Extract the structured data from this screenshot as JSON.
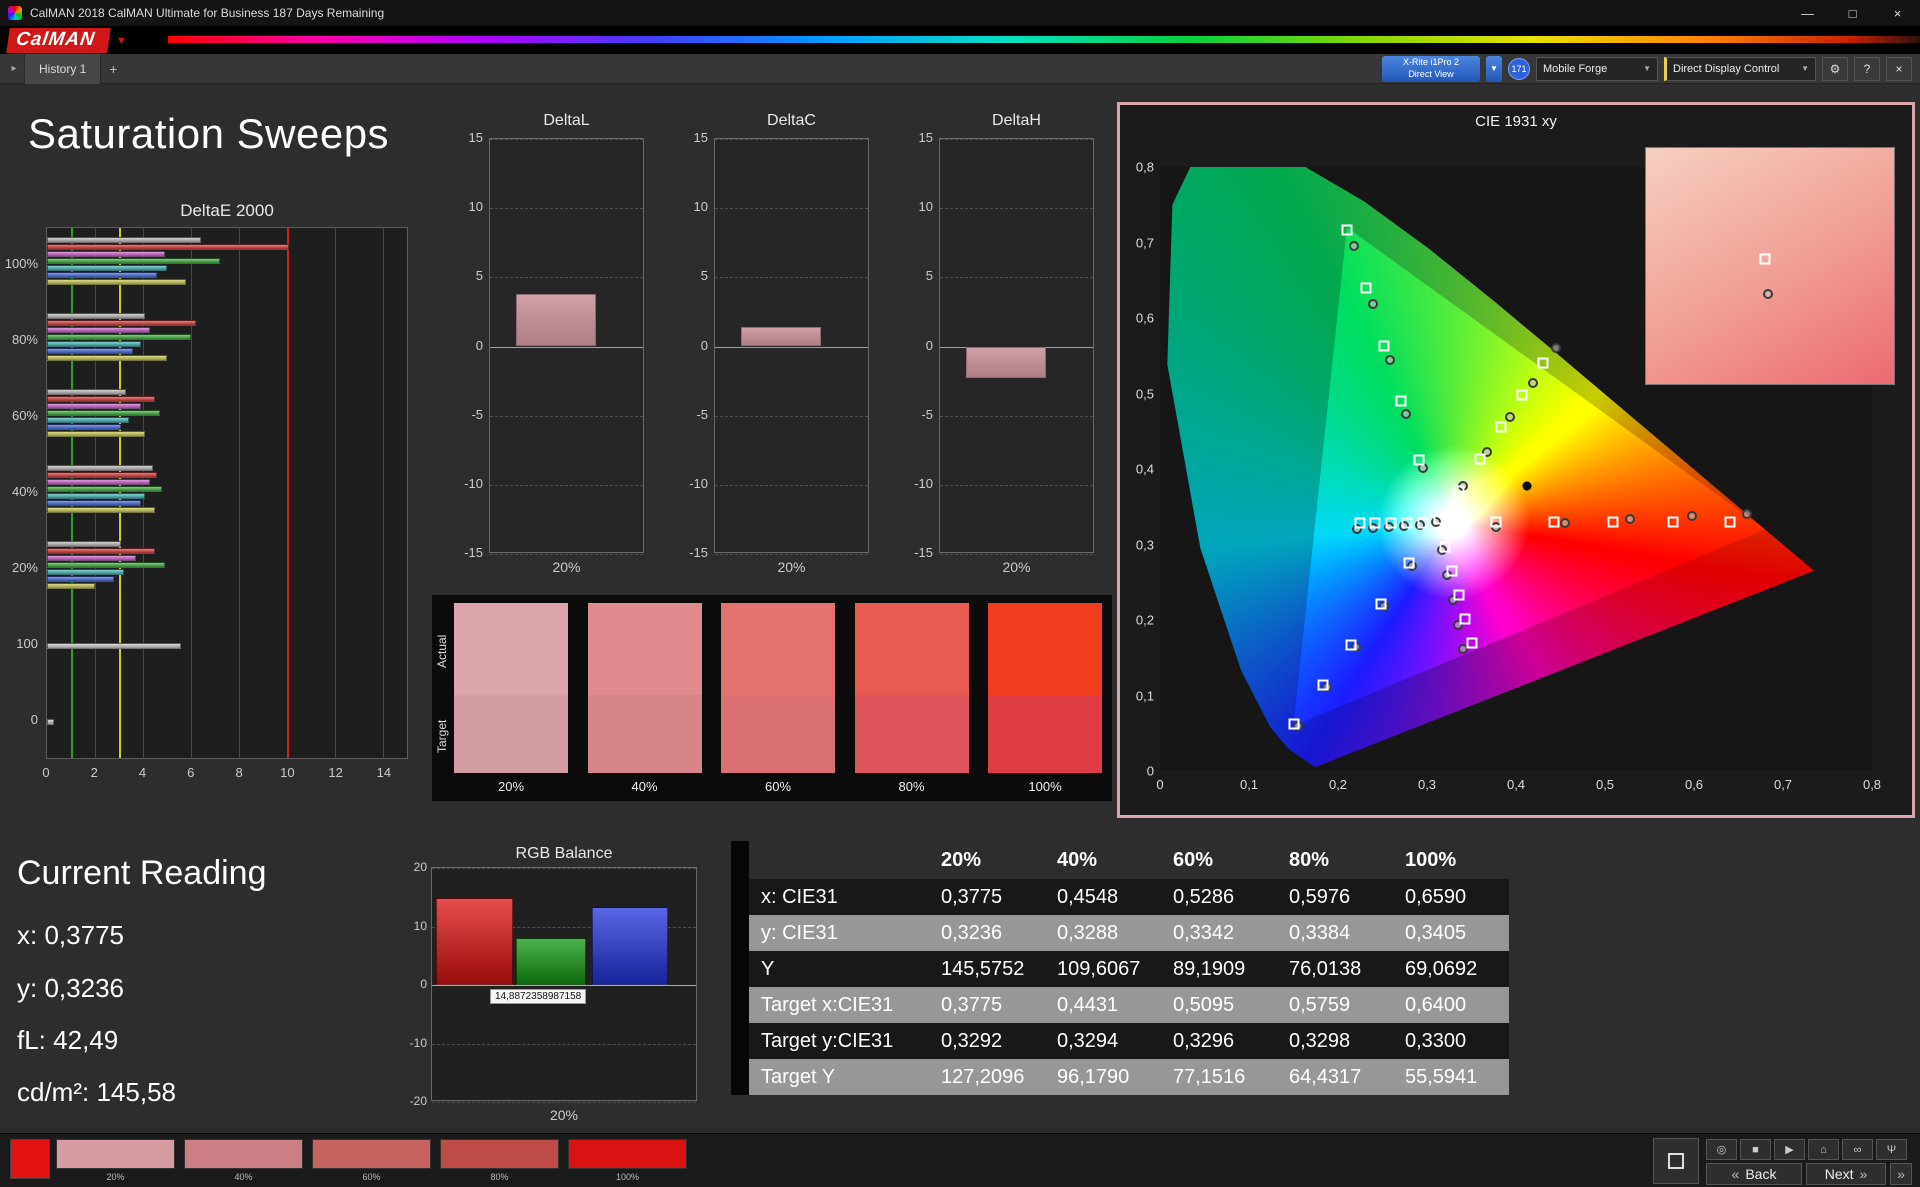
{
  "window": {
    "title": "CalMAN 2018 CalMAN Ultimate for Business 187 Days Remaining",
    "minimize_glyph": "—",
    "maximize_glyph": "□",
    "close_glyph": "×"
  },
  "brand": {
    "logo_text": "CalMAN",
    "caret_glyph": "▼"
  },
  "tab_bar": {
    "nav_glyph": "▸",
    "history_tab": "History 1",
    "add_tab_glyph": "+"
  },
  "device_bar": {
    "meter_line1": "X-Rite i1Pro 2",
    "meter_line2": "Direct View",
    "caret_glyph": "▼",
    "badge": "171",
    "source": "Mobile Forge",
    "display_control": "Direct Display Control",
    "gear_glyph": "⚙",
    "help_glyph": "?",
    "close_glyph": "×"
  },
  "page": {
    "title": "Saturation Sweeps"
  },
  "current_reading": {
    "title": "Current Reading",
    "x_label": "x:",
    "x_value": "0,3775",
    "y_label": "y:",
    "y_value": "0,3236",
    "fl_label": "fL:",
    "fl_value": "42,49",
    "cd_label": "cd/m²:",
    "cd_value": "145,58"
  },
  "chart_data": {
    "deltae2000": {
      "type": "bar",
      "title": "DeltaE 2000",
      "xlim": [
        0,
        15
      ],
      "xticks": [
        0,
        2,
        4,
        6,
        8,
        10,
        12,
        14
      ],
      "ref_lines": [
        {
          "value": 1,
          "color": "#1fa81f"
        },
        {
          "value": 3,
          "color": "#cfcf1f"
        },
        {
          "value": 10,
          "color": "#cf1f1f"
        }
      ],
      "groups": [
        {
          "label": "100%",
          "bars": [
            {
              "color": "#b8b8b8",
              "value": 6.4
            },
            {
              "color": "#d43a3a",
              "value": 10.1
            },
            {
              "color": "#cf5fcf",
              "value": 4.9
            },
            {
              "color": "#3fae3f",
              "value": 7.2
            },
            {
              "color": "#3fb9b9",
              "value": 5.0
            },
            {
              "color": "#4668d8",
              "value": 4.6
            },
            {
              "color": "#c9c94a",
              "value": 5.8
            }
          ]
        },
        {
          "label": "80%",
          "bars": [
            {
              "color": "#b8b8b8",
              "value": 4.1
            },
            {
              "color": "#d43a3a",
              "value": 6.2
            },
            {
              "color": "#cf5fcf",
              "value": 4.3
            },
            {
              "color": "#3fae3f",
              "value": 6.0
            },
            {
              "color": "#3fb9b9",
              "value": 3.9
            },
            {
              "color": "#4668d8",
              "value": 3.6
            },
            {
              "color": "#c9c94a",
              "value": 5.0
            }
          ]
        },
        {
          "label": "60%",
          "bars": [
            {
              "color": "#b8b8b8",
              "value": 3.3
            },
            {
              "color": "#d43a3a",
              "value": 4.5
            },
            {
              "color": "#cf5fcf",
              "value": 3.9
            },
            {
              "color": "#3fae3f",
              "value": 4.7
            },
            {
              "color": "#3fb9b9",
              "value": 3.4
            },
            {
              "color": "#4668d8",
              "value": 3.1
            },
            {
              "color": "#c9c94a",
              "value": 4.1
            }
          ]
        },
        {
          "label": "40%",
          "bars": [
            {
              "color": "#b8b8b8",
              "value": 4.4
            },
            {
              "color": "#d43a3a",
              "value": 4.6
            },
            {
              "color": "#cf5fcf",
              "value": 4.3
            },
            {
              "color": "#3fae3f",
              "value": 4.8
            },
            {
              "color": "#3fb9b9",
              "value": 4.1
            },
            {
              "color": "#4668d8",
              "value": 3.9
            },
            {
              "color": "#c9c94a",
              "value": 4.5
            }
          ]
        },
        {
          "label": "20%",
          "bars": [
            {
              "color": "#b8b8b8",
              "value": 3.1
            },
            {
              "color": "#d43a3a",
              "value": 4.5
            },
            {
              "color": "#cf5fcf",
              "value": 3.7
            },
            {
              "color": "#3fae3f",
              "value": 4.9
            },
            {
              "color": "#3fb9b9",
              "value": 3.2
            },
            {
              "color": "#4668d8",
              "value": 2.8
            },
            {
              "color": "#c9c94a",
              "value": 2.0
            }
          ]
        },
        {
          "label": "100",
          "bars": [
            {
              "color": "#c8c8c8",
              "value": 5.6
            }
          ]
        },
        {
          "label": "0",
          "bars": [
            {
              "color": "#c8c8c8",
              "value": 0.3
            }
          ]
        }
      ]
    },
    "delta_axis": {
      "ymin": -15,
      "ymax": 15,
      "yticks": [
        15,
        10,
        5,
        0,
        -5,
        -10,
        -15
      ],
      "xtick": "20%",
      "bar_color": "#c5989d"
    },
    "delta_small": [
      {
        "type": "bar",
        "title": "DeltaL",
        "value": 3.8
      },
      {
        "type": "bar",
        "title": "DeltaC",
        "value": 1.4
      },
      {
        "type": "bar",
        "title": "DeltaH",
        "value": -2.3
      }
    ],
    "rgb_balance": {
      "type": "bar",
      "title": "RGB Balance",
      "ymin": -20,
      "ymax": 20,
      "yticks": [
        20,
        10,
        0,
        -10,
        -20
      ],
      "xtick": "20%",
      "bars": [
        {
          "name": "red",
          "color": "#dd1111",
          "value": 14.9
        },
        {
          "name": "green",
          "color": "#119911",
          "value": 8.0
        },
        {
          "name": "blue",
          "color": "#2233dd",
          "value": 13.4
        }
      ],
      "tooltip": "14,8872358987158"
    },
    "cie": {
      "type": "scatter",
      "title": "CIE 1931 xy",
      "xlim": [
        0,
        0.8
      ],
      "ylim": [
        0,
        0.8
      ],
      "xticks": [
        "0",
        "0,1",
        "0,2",
        "0,3",
        "0,4",
        "0,5",
        "0,6",
        "0,7",
        "0,8"
      ],
      "yticks": [
        "0,8",
        "0,7",
        "0,6",
        "0,5",
        "0,4",
        "0,3",
        "0,2",
        "0,1",
        "0"
      ],
      "gamut_triangle": [
        [
          0.21,
          0.72
        ],
        [
          0.68,
          0.32
        ],
        [
          0.15,
          0.06
        ]
      ],
      "targets": [
        [
          0.21,
          0.717
        ],
        [
          0.232,
          0.64
        ],
        [
          0.252,
          0.563
        ],
        [
          0.271,
          0.49
        ],
        [
          0.291,
          0.412
        ],
        [
          0.313,
          0.334
        ],
        [
          0.3775,
          0.3292
        ],
        [
          0.4431,
          0.3294
        ],
        [
          0.5095,
          0.3296
        ],
        [
          0.5759,
          0.3298
        ],
        [
          0.64,
          0.33
        ],
        [
          0.295,
          0.329
        ],
        [
          0.277,
          0.329
        ],
        [
          0.259,
          0.329
        ],
        [
          0.242,
          0.329
        ],
        [
          0.225,
          0.329
        ],
        [
          0.28,
          0.275
        ],
        [
          0.248,
          0.221
        ],
        [
          0.215,
          0.167
        ],
        [
          0.183,
          0.114
        ],
        [
          0.15,
          0.062
        ],
        [
          0.32,
          0.297
        ],
        [
          0.328,
          0.265
        ],
        [
          0.336,
          0.233
        ],
        [
          0.343,
          0.201
        ],
        [
          0.351,
          0.17
        ],
        [
          0.336,
          0.371
        ],
        [
          0.36,
          0.413
        ],
        [
          0.383,
          0.455
        ],
        [
          0.407,
          0.498
        ],
        [
          0.43,
          0.54
        ]
      ],
      "measurements": [
        [
          0.218,
          0.695
        ],
        [
          0.239,
          0.618
        ],
        [
          0.258,
          0.545
        ],
        [
          0.276,
          0.473
        ],
        [
          0.295,
          0.401
        ],
        [
          0.31,
          0.33
        ],
        [
          0.3775,
          0.3236
        ],
        [
          0.4548,
          0.3288
        ],
        [
          0.5286,
          0.3342
        ],
        [
          0.5976,
          0.3384
        ],
        [
          0.659,
          0.3405
        ],
        [
          0.292,
          0.326
        ],
        [
          0.274,
          0.325
        ],
        [
          0.257,
          0.323
        ],
        [
          0.239,
          0.322
        ],
        [
          0.221,
          0.32
        ],
        [
          0.283,
          0.272
        ],
        [
          0.252,
          0.218
        ],
        [
          0.22,
          0.164
        ],
        [
          0.188,
          0.111
        ],
        [
          0.155,
          0.06
        ],
        [
          0.317,
          0.293
        ],
        [
          0.323,
          0.26
        ],
        [
          0.329,
          0.227
        ],
        [
          0.335,
          0.194
        ],
        [
          0.341,
          0.161
        ],
        [
          0.341,
          0.378
        ],
        [
          0.367,
          0.423
        ],
        [
          0.393,
          0.469
        ],
        [
          0.419,
          0.514
        ],
        [
          0.445,
          0.56
        ]
      ],
      "current": [
        0.412,
        0.377
      ],
      "inset": {
        "colors": [
          "#f6d0c2",
          "#f19d92",
          "#ec6a72"
        ],
        "target": [
          0.48,
          0.47
        ],
        "measured": [
          0.49,
          0.62
        ]
      }
    }
  },
  "saturation_swatches": {
    "row_labels": [
      "Actual",
      "Target"
    ],
    "columns": [
      {
        "label": "20%",
        "actual": "#dca4ab",
        "target": "#d49da3"
      },
      {
        "label": "40%",
        "actual": "#e08b8e",
        "target": "#d88589"
      },
      {
        "label": "60%",
        "actual": "#e47370",
        "target": "#da6f74"
      },
      {
        "label": "80%",
        "actual": "#e95a50",
        "target": "#dd555b"
      },
      {
        "label": "100%",
        "actual": "#f23d1f",
        "target": "#e03c46"
      }
    ]
  },
  "table": {
    "headers": [
      "",
      "20%",
      "40%",
      "60%",
      "80%",
      "100%"
    ],
    "rows": [
      {
        "label": "x: CIE31",
        "values": [
          "0,3775",
          "0,4548",
          "0,5286",
          "0,5976",
          "0,6590"
        ]
      },
      {
        "label": "y: CIE31",
        "values": [
          "0,3236",
          "0,3288",
          "0,3342",
          "0,3384",
          "0,3405"
        ]
      },
      {
        "label": "Y",
        "values": [
          "145,5752",
          "109,6067",
          "89,1909",
          "76,0138",
          "69,0692"
        ]
      },
      {
        "label": "Target x:CIE31",
        "values": [
          "0,3775",
          "0,4431",
          "0,5095",
          "0,5759",
          "0,6400"
        ]
      },
      {
        "label": "Target y:CIE31",
        "values": [
          "0,3292",
          "0,3294",
          "0,3296",
          "0,3298",
          "0,3300"
        ]
      },
      {
        "label": "Target Y",
        "values": [
          "127,2096",
          "96,1790",
          "77,1516",
          "64,4317",
          "55,5941"
        ]
      }
    ]
  },
  "bottom_bar": {
    "current_patch_color": "#e31313",
    "swatches": [
      {
        "label": "20%",
        "color": "#d79ba2"
      },
      {
        "label": "40%",
        "color": "#cd7e84"
      },
      {
        "label": "60%",
        "color": "#c4635f"
      },
      {
        "label": "80%",
        "color": "#bf4b47"
      },
      {
        "label": "100%",
        "color": "#da1212"
      }
    ],
    "icon_buttons": [
      {
        "name": "aperture-icon",
        "glyph": "◎"
      },
      {
        "name": "stop-icon",
        "glyph": "■"
      },
      {
        "name": "play-icon",
        "glyph": "▶"
      },
      {
        "name": "home-icon",
        "glyph": "⌂"
      },
      {
        "name": "loop-icon",
        "glyph": "∞"
      },
      {
        "name": "usb-icon",
        "glyph": "Ψ"
      }
    ],
    "back_chevron": "«",
    "back_label": "Back",
    "next_label": "Next",
    "next_chevron": "»",
    "fastforward_glyph": "»"
  }
}
